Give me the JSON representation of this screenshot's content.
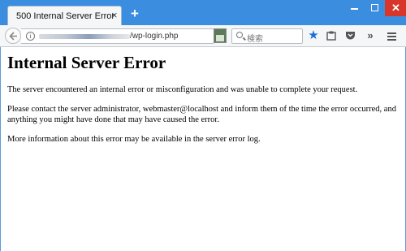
{
  "browser": {
    "tab_title": "500 Internal Server Error",
    "tab_close": "×",
    "new_tab": "+",
    "window_close": "✕",
    "url_visible": "/wp-login.php",
    "search_placeholder": "検索",
    "reload_glyph": "↻",
    "overflow_glyph": "»",
    "accent_color": "#3b8de0",
    "bookmark_color": "#1d6fd8",
    "icons": [
      "back-arrow-icon",
      "info-icon",
      "reload-icon",
      "search-icon",
      "bookmark-star-icon",
      "reading-list-icon",
      "pocket-icon",
      "overflow-icon",
      "menu-icon"
    ]
  },
  "page": {
    "heading": "Internal Server Error",
    "paragraph1": "The server encountered an internal error or misconfiguration and was unable to complete your request.",
    "paragraph2": "Please contact the server administrator, webmaster@localhost and inform them of the time the error occurred, and anything you might have done that may have caused the error.",
    "paragraph3": "More information about this error may be available in the server error log."
  }
}
